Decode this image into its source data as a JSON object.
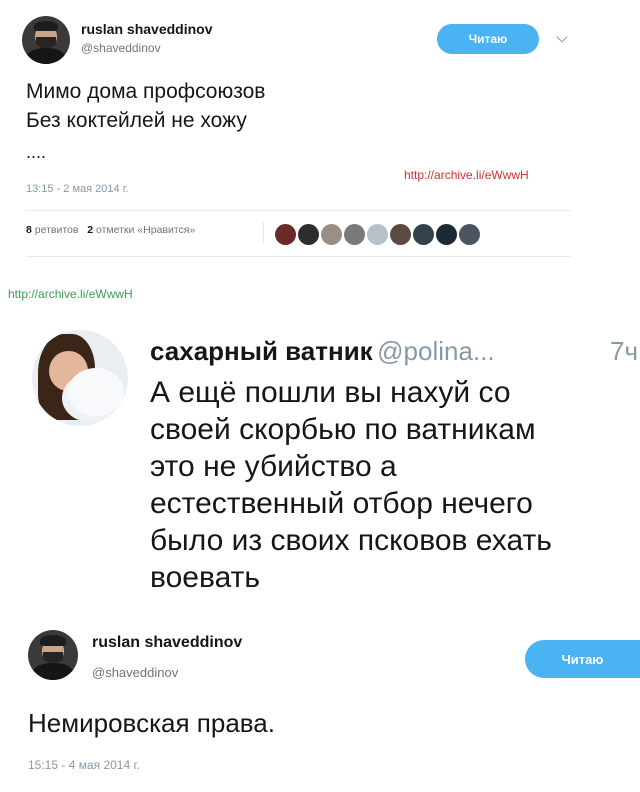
{
  "tweet1": {
    "name": "ruslan shaveddinov",
    "handle": "@shaveddinov",
    "follow_label": "Читаю",
    "text_line1": "Мимо дома профсоюзов",
    "text_line2": "Без коктейлей не хожу",
    "text_line3": "....",
    "archive_link": "http://archive.li/eWwwH",
    "timestamp": "13:15 - 2 мая 2014 г.",
    "retweets_count": "8",
    "retweets_label": "ретвитов",
    "likes_count": "2",
    "likes_label": "отметки «Нравится»",
    "liker_colors": [
      "#6a2a2a",
      "#2d2d2d",
      "#9a8f86",
      "#7a7a7a",
      "#b9c1c8",
      "#5a4a40",
      "#33414a",
      "#1e2a33",
      "#4a5560"
    ]
  },
  "middle_link": "http://archive.li/eWwwH",
  "tweet2": {
    "name": "сахарный ватник",
    "handle": "@polina...",
    "time": "7ч",
    "text_lines": [
      "А ещё пошли вы нахуй со",
      "своей скорбью по ватникам",
      "это не убийство а",
      "естественный отбор нечего",
      "было из своих псковов ехать",
      "воевать"
    ]
  },
  "tweet3": {
    "name": "ruslan shaveddinov",
    "handle": "@shaveddinov",
    "follow_label": "Читаю",
    "text": "Немировская права.",
    "timestamp": "15:15 - 4 мая 2014 г."
  },
  "colors": {
    "follow_bg": "#4ab3f4",
    "link_red": "#cc3333",
    "link_green": "#3aa05a"
  }
}
